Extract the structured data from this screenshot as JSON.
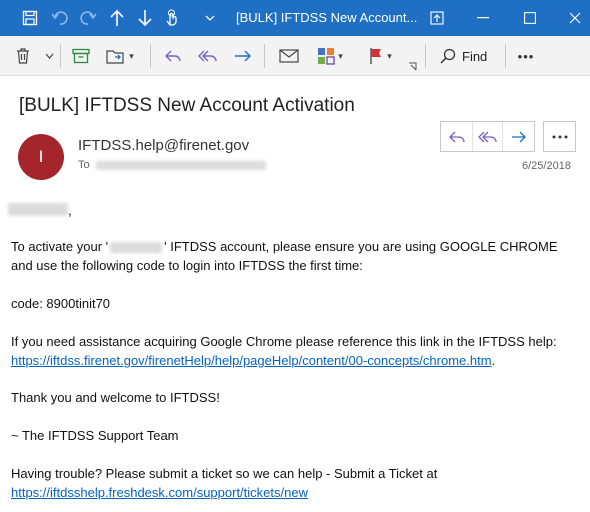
{
  "window": {
    "title": "[BULK] IFTDSS New Account...",
    "quick_access": [
      "save-icon",
      "undo-icon",
      "redo-icon",
      "up-arrow-icon",
      "down-arrow-icon",
      "touch-mode-icon",
      "customize-qat-icon"
    ],
    "controls": [
      "popout-icon",
      "minimize-icon",
      "maximize-icon",
      "close-icon"
    ]
  },
  "ribbon": {
    "find_label": "Find",
    "more_label": "•••"
  },
  "email": {
    "subject": "[BULK] IFTDSS New Account Activation",
    "avatar_initial": "I",
    "sender": "IFTDSS.help@firenet.gov",
    "to_label": "To",
    "date": "6/25/2018",
    "body": {
      "greeting_suffix": ",",
      "para1_line1_a": "To activate your '",
      "para1_line1_b": "' IFTDSS account, please ensure you are using GOOGLE CHROME",
      "para1_line2": "and use the following code to login into IFTDSS the first time:",
      "code_line": "code: 8900tinit70",
      "help_line": "If you need assistance acquiring Google Chrome please reference this link in the IFTDSS help:",
      "help_link": "https://iftdss.firenet.gov/firenetHelp/help/pageHelp/content/00-concepts/chrome.htm",
      "help_link_suffix": ".",
      "thanks_line": "Thank you and welcome to IFTDSS!",
      "signoff": "~ The IFTDSS Support Team",
      "trouble_line": "Having trouble? Please submit a ticket so we can help - Submit a Ticket at",
      "ticket_link": "https://iftdsshelp.freshdesk.com/support/tickets/new"
    }
  },
  "colors": {
    "titlebar": "#1f6fc5",
    "avatar": "#a4262c",
    "link": "#0563c1",
    "accent": "#5b5fc7"
  }
}
